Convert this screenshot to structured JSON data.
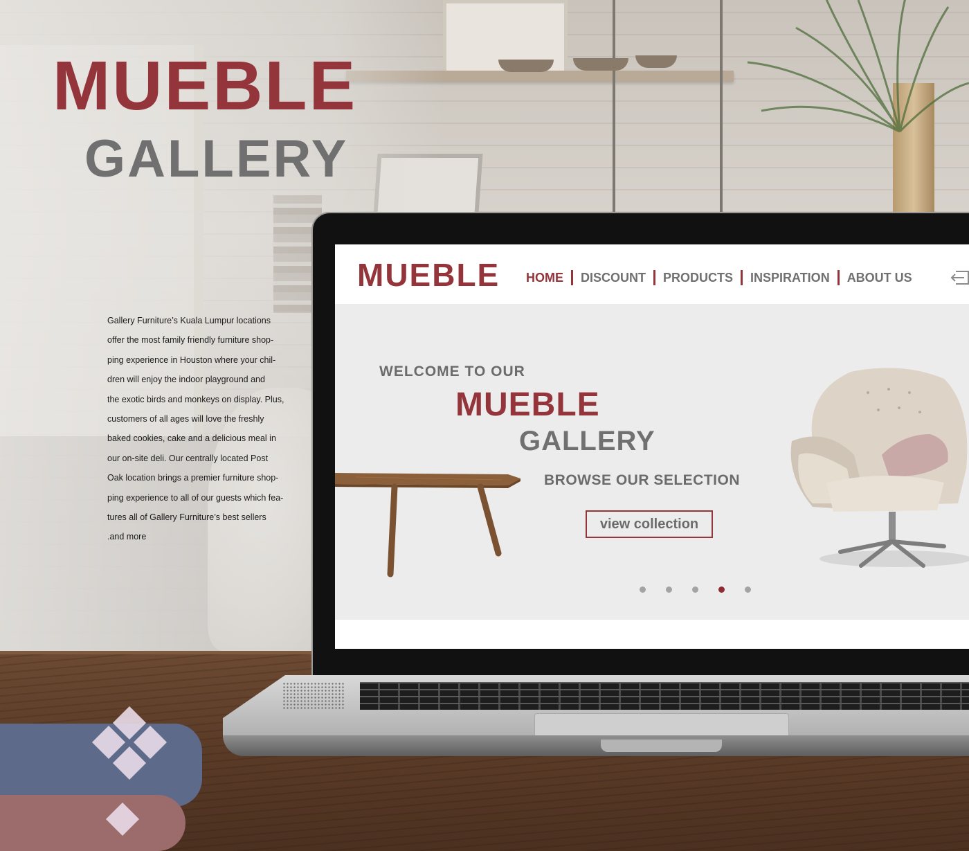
{
  "poster": {
    "title": "MUEBLE",
    "subtitle": "GALLERY",
    "description": "Gallery Furniture’s Kuala Lumpur locations\noffer the most family friendly furniture shop-\nping experience in Houston where your chil-\ndren will enjoy the indoor playground and\nthe exotic birds and monkeys on display. Plus,\ncustomers of all ages will love the freshly\nbaked cookies, cake and a delicious meal in\nour on-site deli. Our centrally located Post\nOak location brings a premier furniture shop-\nping experience to all of our guests which fea-\ntures all of Gallery Furniture’s best sellers\n.and more"
  },
  "site": {
    "logo": "MUEBLE",
    "nav": [
      {
        "label": "HOME",
        "active": true
      },
      {
        "label": "DISCOUNT",
        "active": false
      },
      {
        "label": "PRODUCTS",
        "active": false
      },
      {
        "label": "INSPIRATION",
        "active": false
      },
      {
        "label": "ABOUT US",
        "active": false
      }
    ],
    "login_icon": "sign-in-arrow-icon"
  },
  "hero": {
    "welcome": "WELCOME TO OUR",
    "title": "MUEBLE",
    "subtitle": "GALLERY",
    "browse": "BROWSE OUR SELECTION",
    "cta_label": "view collection",
    "slides_total": 5,
    "active_slide": 4
  },
  "colors": {
    "brand_red": "#93353a",
    "text_gray": "#707070",
    "hero_bg": "#ececec",
    "dot_active": "#8e2a30",
    "dot_inactive": "#a3a3a3"
  }
}
